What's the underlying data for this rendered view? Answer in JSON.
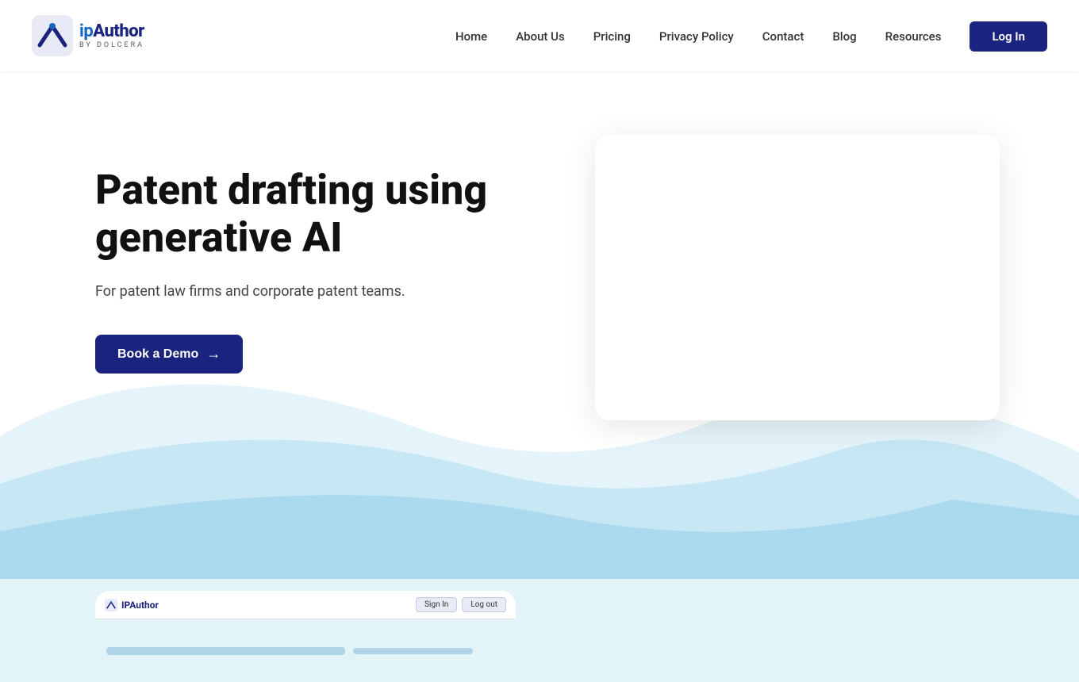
{
  "nav": {
    "logo": {
      "main_text": "IPAuthor",
      "main_prefix": "",
      "sub_text": "BY DOLCERA"
    },
    "links": [
      {
        "label": "Home",
        "id": "home"
      },
      {
        "label": "About Us",
        "id": "about"
      },
      {
        "label": "Pricing",
        "id": "pricing"
      },
      {
        "label": "Privacy Policy",
        "id": "privacy"
      },
      {
        "label": "Contact",
        "id": "contact"
      },
      {
        "label": "Blog",
        "id": "blog"
      },
      {
        "label": "Resources",
        "id": "resources"
      }
    ],
    "login_label": "Log In"
  },
  "hero": {
    "title": "Patent drafting using generative AI",
    "subtitle": "For patent law firms and corporate patent teams.",
    "cta_label": "Book a Demo"
  },
  "bottom_card": {
    "logo_text": "IPAuthor",
    "btn1": "Sign In",
    "btn2": "Log out"
  }
}
